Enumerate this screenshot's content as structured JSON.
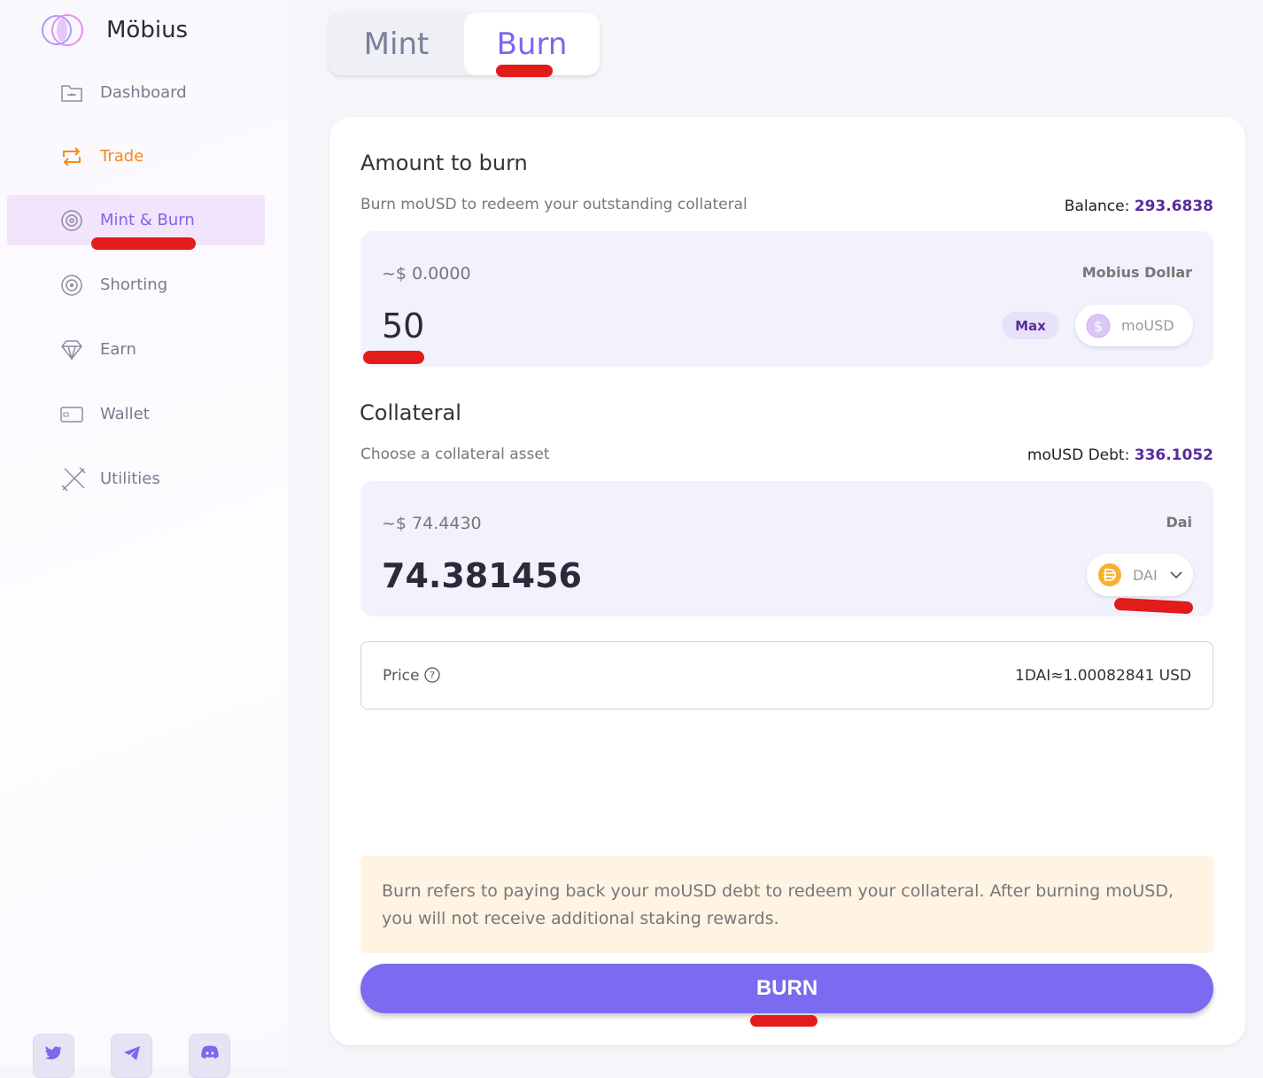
{
  "app": {
    "name": "Möbius"
  },
  "sidebar": {
    "items": [
      {
        "label": "Dashboard"
      },
      {
        "label": "Trade"
      },
      {
        "label": "Mint & Burn"
      },
      {
        "label": "Shorting"
      },
      {
        "label": "Earn"
      },
      {
        "label": "Wallet"
      },
      {
        "label": "Utilities"
      }
    ]
  },
  "tabs": [
    {
      "label": "Mint"
    },
    {
      "label": "Burn"
    }
  ],
  "burn": {
    "title": "Amount to burn",
    "subtitle": "Burn moUSD to redeem your outstanding collateral",
    "balance_label": "Balance: ",
    "balance": "293.6838",
    "usd_value": "~$ 0.0000",
    "token_name": "Mobius Dollar",
    "amount": "50",
    "max_label": "Max",
    "token": "moUSD"
  },
  "collateral": {
    "title": "Collateral",
    "subtitle": "Choose a collateral asset",
    "debt_label": "moUSD Debt: ",
    "debt": "336.1052",
    "usd_value": "~$ 74.4430",
    "token_name": "Dai",
    "amount": "74.381456",
    "token": "DAI"
  },
  "price": {
    "label": "Price",
    "value": "1DAI≈1.00082841 USD"
  },
  "note": "Burn refers to paying back your moUSD debt to redeem your collateral. After burning moUSD, you will not receive additional staking rewards.",
  "button": "BURN",
  "colors": {
    "accent": "#7b67ee",
    "trade": "#f7891c",
    "annotation": "#e21b1b"
  }
}
